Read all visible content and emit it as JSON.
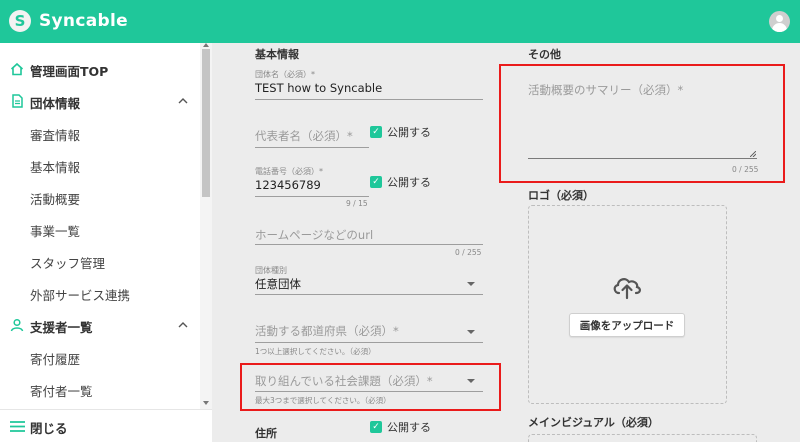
{
  "app": {
    "brand": "Syncable",
    "logo_letter": "S"
  },
  "sidebar": {
    "top_item": "管理画面TOP",
    "group1": {
      "label": "団体情報",
      "items": [
        "審査情報",
        "基本情報",
        "活動概要",
        "事業一覧",
        "スタッフ管理",
        "外部サービス連携"
      ]
    },
    "group2": {
      "label": "支援者一覧",
      "items": [
        "寄付履歴",
        "寄付者一覧"
      ]
    },
    "close_label": "閉じる"
  },
  "basic": {
    "section_title": "基本情報",
    "org_name": {
      "label": "団体名（必須）*",
      "value": "TEST how to Syncable"
    },
    "representative": {
      "placeholder": "代表者名（必須）*",
      "public_label": "公開する"
    },
    "phone": {
      "label": "電話番号（必須）*",
      "value": "123456789",
      "counter": "9 / 15",
      "public_label": "公開する"
    },
    "homepage": {
      "placeholder": "ホームページなどのurl",
      "counter": "0 / 255"
    },
    "org_type": {
      "label": "団体種別",
      "value": "任意団体"
    },
    "prefecture": {
      "placeholder": "活動する都道府県（必須）*",
      "hint": "1つ以上選択してください。（必須）"
    },
    "social_issue": {
      "placeholder": "取り組んでいる社会課題（必須）*",
      "hint": "最大3つまで選択してください。（必須）"
    },
    "address": {
      "label": "住所",
      "public_label": "公開する"
    }
  },
  "other": {
    "section_title": "その他",
    "summary": {
      "placeholder": "活動概要のサマリー（必須）*",
      "counter": "0 / 255"
    },
    "logo": {
      "label": "ロゴ（必須）",
      "upload_button": "画像をアップロード"
    },
    "main_visual": {
      "label": "メインビジュアル（必須）"
    }
  },
  "colors": {
    "brand": "#1fc79a",
    "highlight": "#ea1b1b"
  }
}
